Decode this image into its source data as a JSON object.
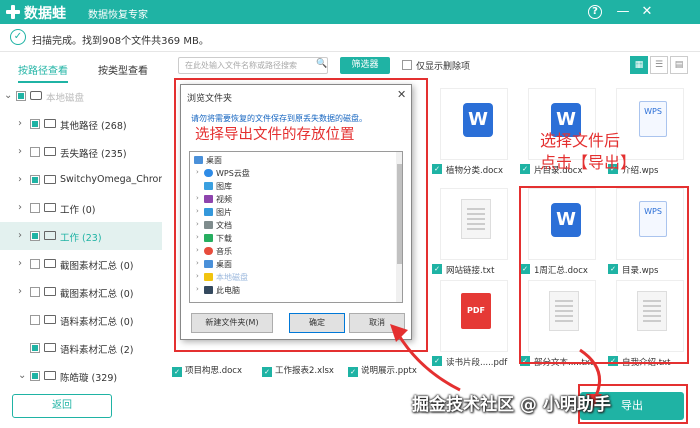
{
  "app": {
    "title": "数据蛙",
    "subtitle": "数据恢复专家",
    "help": "?",
    "minimize": "—",
    "close": "✕"
  },
  "status": {
    "check": "✓",
    "text": "扫描完成。找到908个文件共369 MB。"
  },
  "tabs": {
    "path": "按路径查看",
    "type": "按类型查看"
  },
  "tree": {
    "root": {
      "label": "本地磁盘"
    },
    "items": [
      {
        "label": "其他路径 (268)"
      },
      {
        "label": "丢失路径 (235)"
      },
      {
        "label": "SwitchyOmega_Chromium"
      },
      {
        "label": "工作 (0)"
      },
      {
        "label": "工作 (23)"
      },
      {
        "label": "截图素材汇总 (0)"
      },
      {
        "label": "截图素材汇总 (0)"
      },
      {
        "label": "语料素材汇总 (0)"
      },
      {
        "label": "语料素材汇总 (2)"
      },
      {
        "label": "陈皓璇 (329)"
      }
    ],
    "arrow": "›",
    "arrow_open": "⌄"
  },
  "toolbar": {
    "search_placeholder": "在此处输入文件名称或路径搜索",
    "search_icon": "🔍",
    "filter": "筛选器",
    "deleted_only": "仅显示删除项",
    "view_grid": "▦",
    "view_list": "☰",
    "view_detail": "▤"
  },
  "files": [
    {
      "name": "植物分类.docx",
      "kind": "word"
    },
    {
      "name": "片目录.docx",
      "kind": "word"
    },
    {
      "name": "介绍.wps",
      "kind": "wps"
    },
    {
      "name": "网站链接.txt",
      "kind": "txt"
    },
    {
      "name": "1周汇总.docx",
      "kind": "word"
    },
    {
      "name": "目录.wps",
      "kind": "wps"
    },
    {
      "name": "读书片段.....pdf",
      "kind": "pdf"
    },
    {
      "name": "部分文本.....txt",
      "kind": "txt"
    },
    {
      "name": "自我介绍.txt",
      "kind": "txt"
    }
  ],
  "bottom_files": [
    "项目构思.docx",
    "工作报表2.xlsx",
    "说明展示.pptx"
  ],
  "icons": {
    "word": "W",
    "wps": "WPS",
    "pdf": "PDF",
    "check": "✓"
  },
  "buttons": {
    "back": "返回",
    "export": "导出"
  },
  "annotations": {
    "right": "选择文件后\n点击【导出】"
  },
  "watermark": "掘金技术社区 @ 小明助手",
  "dialog": {
    "title": "浏览文件夹",
    "close": "✕",
    "prompt": "请勿将需要恢复的文件保存到原丢失数据的磁盘。",
    "instruction": "选择导出文件的存放位置",
    "nodes": [
      {
        "label": "桌面"
      },
      {
        "label": "WPS云盘"
      },
      {
        "label": "图库"
      },
      {
        "label": "视频"
      },
      {
        "label": "图片"
      },
      {
        "label": "文档"
      },
      {
        "label": "下载"
      },
      {
        "label": "音乐"
      },
      {
        "label": "桌面"
      },
      {
        "label": "本地磁盘"
      },
      {
        "label": "此电脑"
      }
    ],
    "new_folder": "新建文件夹(M)",
    "ok": "确定",
    "cancel": "取消"
  },
  "colors": {
    "accent": "#1fb3a4",
    "highlight": "#e43030",
    "word": "#2b6fd7"
  }
}
